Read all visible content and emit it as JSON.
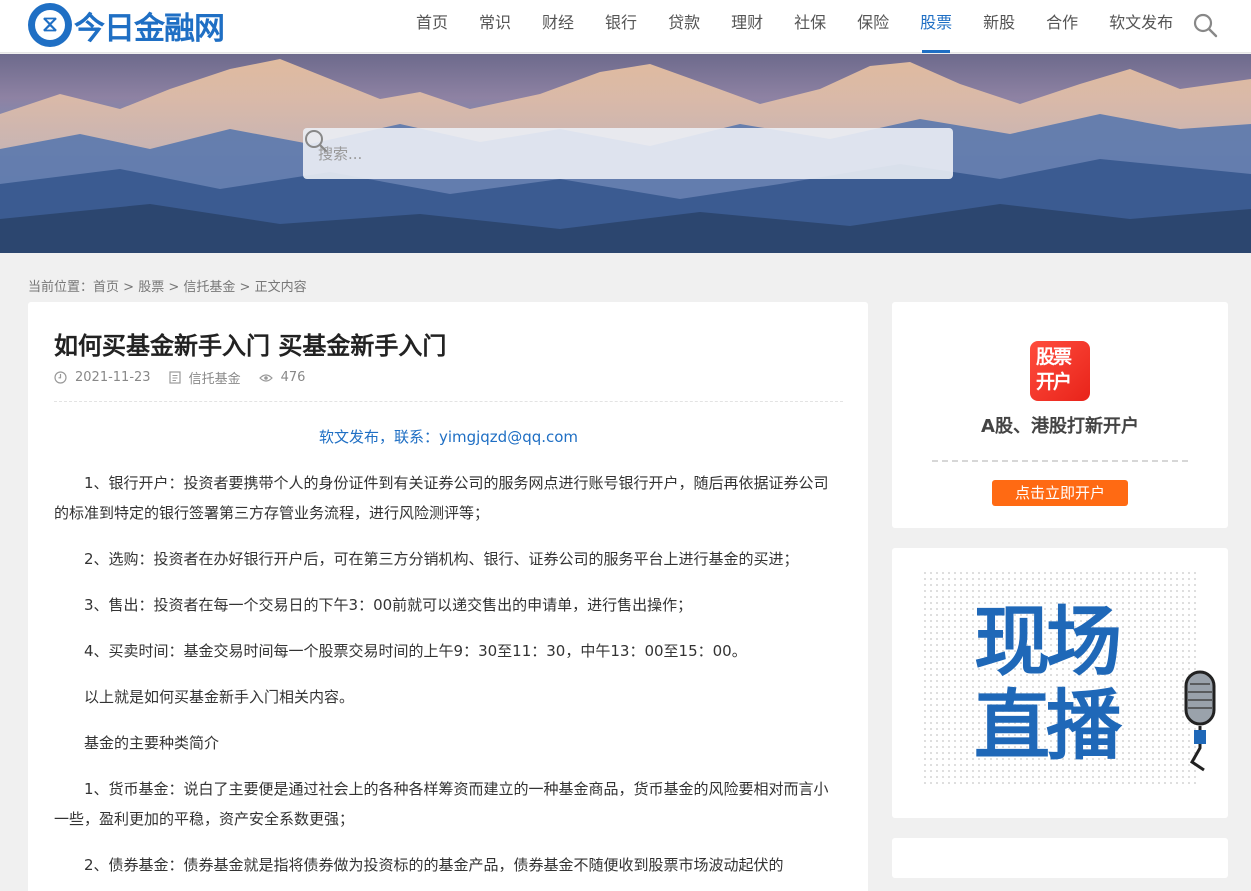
{
  "header": {
    "logo_glyph": "⧖",
    "logo_text": "今日金融网",
    "brand_color": "#1f6fc4",
    "nav": [
      {
        "label": "首页"
      },
      {
        "label": "常识"
      },
      {
        "label": "财经"
      },
      {
        "label": "银行"
      },
      {
        "label": "贷款"
      },
      {
        "label": "理财"
      },
      {
        "label": "社保"
      },
      {
        "label": "保险"
      },
      {
        "label": "股票",
        "active": true
      },
      {
        "label": "新股"
      },
      {
        "label": "合作"
      },
      {
        "label": "软文发布"
      }
    ],
    "search_icon": "search-icon"
  },
  "banner": {
    "search_placeholder": "搜索..."
  },
  "breadcrumb": {
    "prefix": "当前位置：",
    "items": [
      "首页",
      "股票",
      "信托基金",
      "正文内容"
    ],
    "separator": " > "
  },
  "article": {
    "title": "如何买基金新手入门 买基金新手入门",
    "date": "2021-11-23",
    "category": "信托基金",
    "views": "476",
    "promo": "软文发布，联系：yimgjqzd@qq.com",
    "paragraphs": [
      "1、银行开户：投资者要携带个人的身份证件到有关证券公司的服务网点进行账号银行开户，随后再依据证券公司的标准到特定的银行签署第三方存管业务流程，进行风险测评等；",
      "2、选购：投资者在办好银行开户后，可在第三方分销机构、银行、证券公司的服务平台上进行基金的买进；",
      "3、售出：投资者在每一个交易日的下午3：00前就可以递交售出的申请单，进行售出操作；",
      "4、买卖时间：基金交易时间每一个股票交易时间的上午9：30至11：30，中午13：00至15：00。",
      "以上就是如何买基金新手入门相关内容。",
      "基金的主要种类简介",
      "1、货币基金：说白了主要便是通过社会上的各种各样筹资而建立的一种基金商品，货币基金的风险要相对而言小一些，盈利更加的平稳，资产安全系数更强；",
      "2、债券基金：债券基金就是指将债券做为投资标的的基金产品，债券基金不随便收到股票市场波动起伏的"
    ]
  },
  "sidebar": {
    "app_icon_line1": "股票",
    "app_icon_line2": "开户",
    "promo_title": "A股、港股打新开户",
    "open_button": "点击立即开户",
    "button_color": "#ff6a13",
    "live_line1": "现场",
    "live_line2": "直播"
  }
}
